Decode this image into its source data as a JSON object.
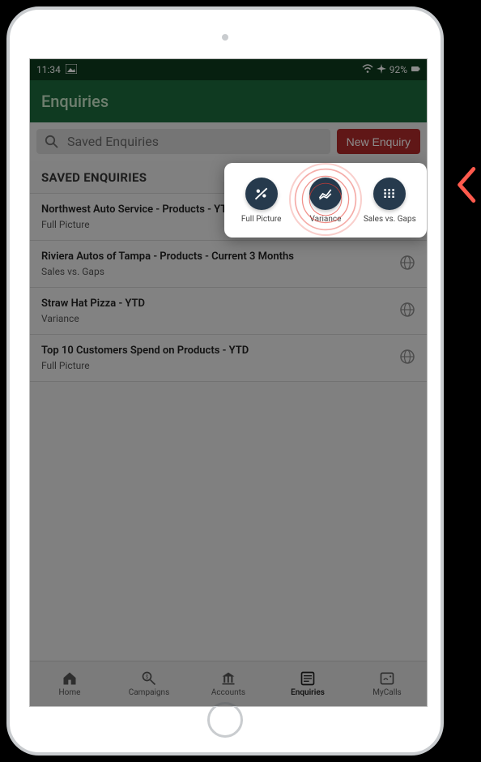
{
  "statusbar": {
    "time": "11:34",
    "battery_pct": "92%"
  },
  "header": {
    "title": "Enquiries"
  },
  "toolbar": {
    "search_placeholder": "Saved Enquiries",
    "new_button": "New Enquiry"
  },
  "section_title": "SAVED ENQUIRIES",
  "rows": [
    {
      "title": "Northwest Auto Service - Products - YTD",
      "sub": "Full Picture",
      "globe": false
    },
    {
      "title": "Riviera Autos of Tampa - Products - Current 3 Months",
      "sub": "Sales vs. Gaps",
      "globe": true
    },
    {
      "title": "Straw Hat Pizza - YTD",
      "sub": "Variance",
      "globe": true
    },
    {
      "title": "Top 10 Customers Spend on Products - YTD",
      "sub": "Full Picture",
      "globe": true
    }
  ],
  "popover": {
    "options": [
      {
        "label": "Full Picture"
      },
      {
        "label": "Variance"
      },
      {
        "label": "Sales vs. Gaps"
      }
    ]
  },
  "bottomnav": {
    "items": [
      {
        "label": "Home"
      },
      {
        "label": "Campaigns"
      },
      {
        "label": "Accounts"
      },
      {
        "label": "Enquiries"
      },
      {
        "label": "MyCalls"
      }
    ],
    "active_index": 3
  }
}
